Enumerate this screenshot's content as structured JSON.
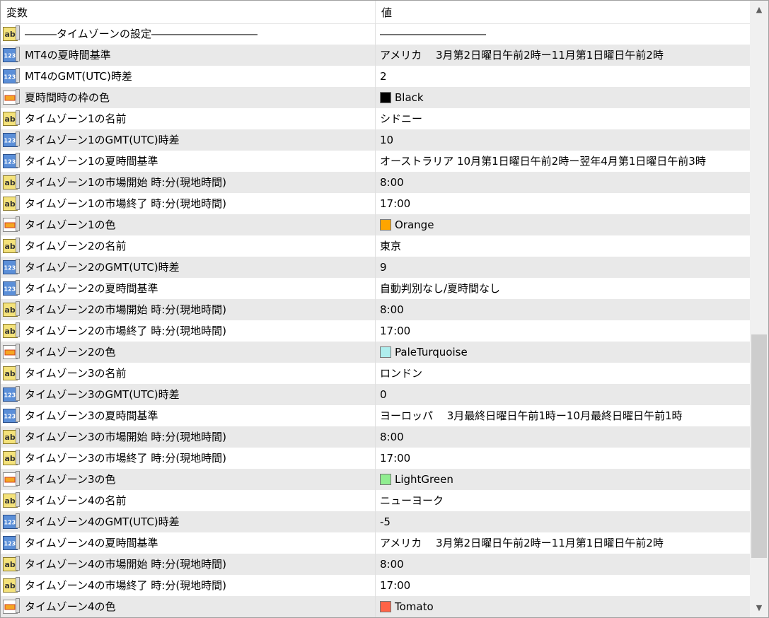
{
  "header": {
    "col_name": "変数",
    "col_value": "値"
  },
  "rows": [
    {
      "type": "ab",
      "name": "―――タイムゾーンの設定――――――――――",
      "value": "――――――――――",
      "separator": true
    },
    {
      "type": "123",
      "name": "MT4の夏時間基準",
      "value": "アメリカ　  3月第2日曜日午前2時ー11月第1日曜日午前2時"
    },
    {
      "type": "123",
      "name": "MT4のGMT(UTC)時差",
      "value": "2"
    },
    {
      "type": "color",
      "name": "夏時間時の枠の色",
      "value": "Black",
      "color": "#000000"
    },
    {
      "type": "ab",
      "name": "タイムゾーン1の名前",
      "value": "シドニー"
    },
    {
      "type": "123",
      "name": "タイムゾーン1のGMT(UTC)時差",
      "value": "10"
    },
    {
      "type": "123",
      "name": "タイムゾーン1の夏時間基準",
      "value": "オーストラリア  10月第1日曜日午前2時ー翌年4月第1日曜日午前3時"
    },
    {
      "type": "ab",
      "name": "タイムゾーン1の市場開始 時:分(現地時間)",
      "value": "8:00"
    },
    {
      "type": "ab",
      "name": "タイムゾーン1の市場終了 時:分(現地時間)",
      "value": "17:00"
    },
    {
      "type": "color",
      "name": "タイムゾーン1の色",
      "value": "Orange",
      "color": "#FFA500"
    },
    {
      "type": "ab",
      "name": "タイムゾーン2の名前",
      "value": "東京"
    },
    {
      "type": "123",
      "name": "タイムゾーン2のGMT(UTC)時差",
      "value": "9"
    },
    {
      "type": "123",
      "name": "タイムゾーン2の夏時間基準",
      "value": "自動判別なし/夏時間なし"
    },
    {
      "type": "ab",
      "name": "タイムゾーン2の市場開始 時:分(現地時間)",
      "value": "8:00"
    },
    {
      "type": "ab",
      "name": "タイムゾーン2の市場終了 時:分(現地時間)",
      "value": "17:00"
    },
    {
      "type": "color",
      "name": "タイムゾーン2の色",
      "value": "PaleTurquoise",
      "color": "#AFEEEE"
    },
    {
      "type": "ab",
      "name": "タイムゾーン3の名前",
      "value": "ロンドン"
    },
    {
      "type": "123",
      "name": "タイムゾーン3のGMT(UTC)時差",
      "value": "0"
    },
    {
      "type": "123",
      "name": "タイムゾーン3の夏時間基準",
      "value": "ヨーロッパ　 3月最終日曜日午前1時ー10月最終日曜日午前1時"
    },
    {
      "type": "ab",
      "name": "タイムゾーン3の市場開始 時:分(現地時間)",
      "value": "8:00"
    },
    {
      "type": "ab",
      "name": "タイムゾーン3の市場終了 時:分(現地時間)",
      "value": "17:00"
    },
    {
      "type": "color",
      "name": "タイムゾーン3の色",
      "value": "LightGreen",
      "color": "#90EE90"
    },
    {
      "type": "ab",
      "name": "タイムゾーン4の名前",
      "value": "ニューヨーク"
    },
    {
      "type": "123",
      "name": "タイムゾーン4のGMT(UTC)時差",
      "value": "-5"
    },
    {
      "type": "123",
      "name": "タイムゾーン4の夏時間基準",
      "value": "アメリカ　  3月第2日曜日午前2時ー11月第1日曜日午前2時"
    },
    {
      "type": "ab",
      "name": "タイムゾーン4の市場開始 時:分(現地時間)",
      "value": "8:00"
    },
    {
      "type": "ab",
      "name": "タイムゾーン4の市場終了 時:分(現地時間)",
      "value": "17:00"
    },
    {
      "type": "color",
      "name": "タイムゾーン4の色",
      "value": "Tomato",
      "color": "#FF6347"
    }
  ],
  "scrollbar": {
    "up_icon": "scroll-up-arrow",
    "down_icon": "scroll-down-arrow"
  }
}
